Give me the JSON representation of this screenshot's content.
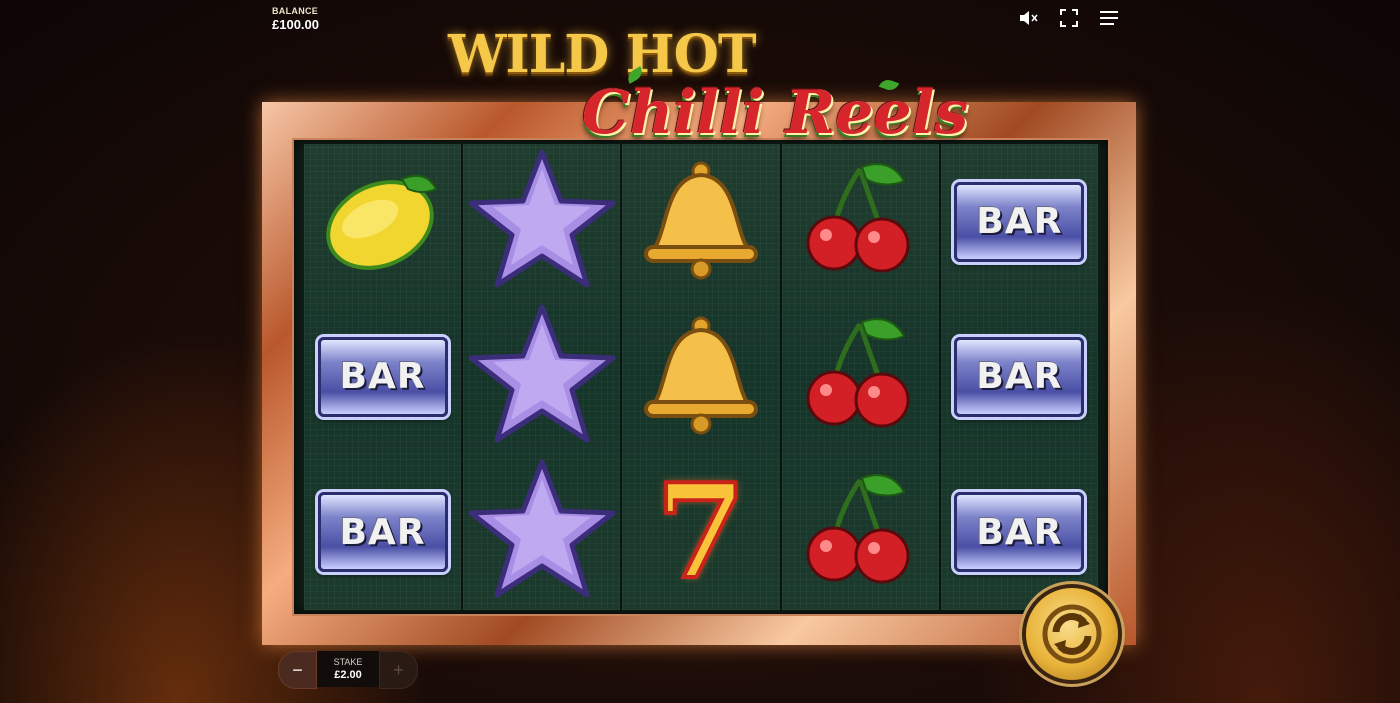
{
  "balance": {
    "label": "BALANCE",
    "value": "£100.00"
  },
  "icons": {
    "sound": "sound-muted-icon",
    "fullscreen": "fullscreen-icon",
    "menu": "menu-icon"
  },
  "logo": {
    "line1": "WILD HOT",
    "line2": "Chilli Reels"
  },
  "reels": [
    [
      "lemon",
      "bar",
      "bar"
    ],
    [
      "star",
      "star",
      "star"
    ],
    [
      "bell",
      "bell",
      "seven"
    ],
    [
      "cherry",
      "cherry",
      "cherry"
    ],
    [
      "bar",
      "bar",
      "bar"
    ]
  ],
  "symbols": {
    "bar_text": "BAR",
    "seven_text": "7"
  },
  "stake": {
    "label": "STAKE",
    "value": "£2.00",
    "minus": "−",
    "plus": "+"
  },
  "colors": {
    "frame": "#c9825a",
    "spin": "#e9b33a",
    "reel_bg": "#1b3a2c",
    "logo_red": "#d6262c",
    "logo_gold": "#f5c84a"
  }
}
